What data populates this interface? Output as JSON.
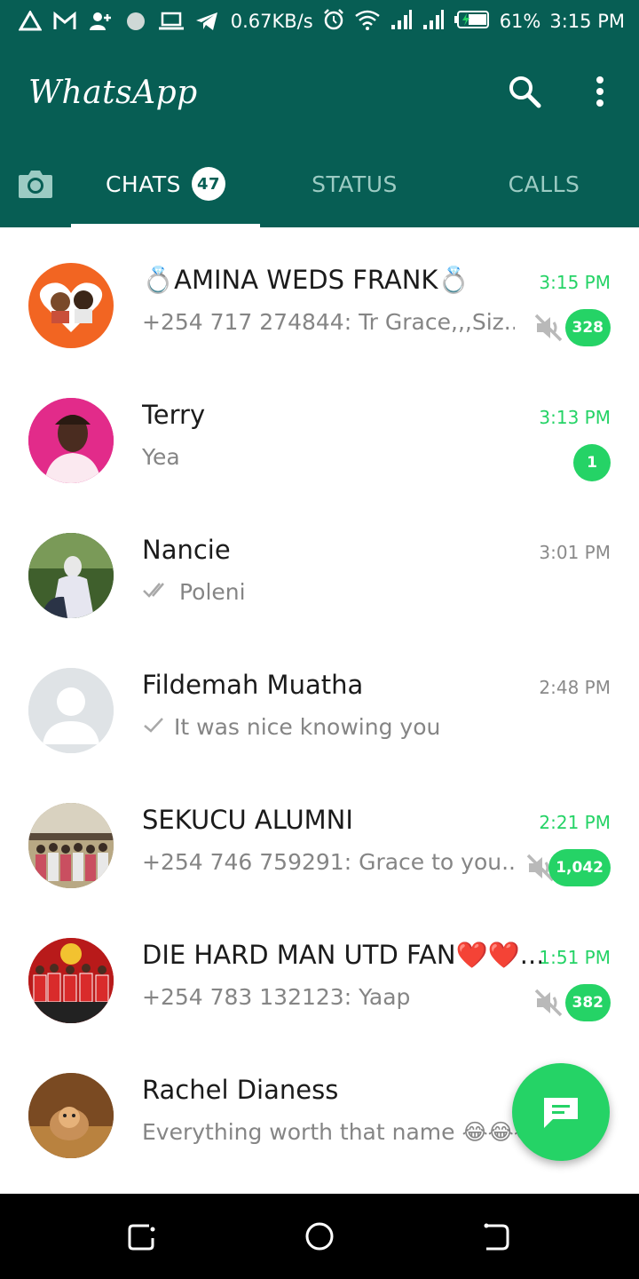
{
  "status_bar": {
    "speed": "0.67KB/s",
    "battery": "61%",
    "time": "3:15 PM"
  },
  "app": {
    "title": "WhatsApp"
  },
  "tabs": {
    "chats_label": "CHATS",
    "chats_count": "47",
    "status_label": "STATUS",
    "calls_label": "CALLS"
  },
  "chats": [
    {
      "name": "💍AMINA WEDS FRANK💍",
      "preview": "+254 717 274844: Tr Grace,,,Siz...",
      "time": "3:15 PM",
      "badge": "328",
      "muted": true,
      "unread": true
    },
    {
      "name": "Terry",
      "preview": "Yea",
      "time": "3:13 PM",
      "badge": "1",
      "muted": false,
      "unread": true
    },
    {
      "name": "Nancie",
      "preview": "Poleni",
      "time": "3:01 PM",
      "badge": "",
      "muted": false,
      "unread": false,
      "ticks": "double"
    },
    {
      "name": "Fildemah Muatha",
      "preview": "It was nice knowing you",
      "time": "2:48 PM",
      "badge": "",
      "muted": false,
      "unread": false,
      "ticks": "single"
    },
    {
      "name": "SEKUCU ALUMNI",
      "preview": "+254 746 759291: Grace to you...",
      "time": "2:21 PM",
      "badge": "1,042",
      "muted": true,
      "unread": true
    },
    {
      "name": "DIE HARD MAN UTD FAN❤️❤️...",
      "preview": "+254 783 132123: Yaap",
      "time": "1:51 PM",
      "badge": "382",
      "muted": true,
      "unread": true
    },
    {
      "name": "Rachel Dianess",
      "preview": "Everything worth that name 😂😂😂",
      "time": "",
      "badge": "",
      "muted": false,
      "unread": true
    }
  ],
  "colors": {
    "header": "#075e54",
    "accent": "#25d366",
    "badge_text": "#ffffff"
  },
  "icons": {
    "search": "search-icon",
    "menu": "more-vertical-icon",
    "camera": "camera-icon",
    "fab": "new-chat-icon",
    "mute": "muted-speaker-icon"
  }
}
